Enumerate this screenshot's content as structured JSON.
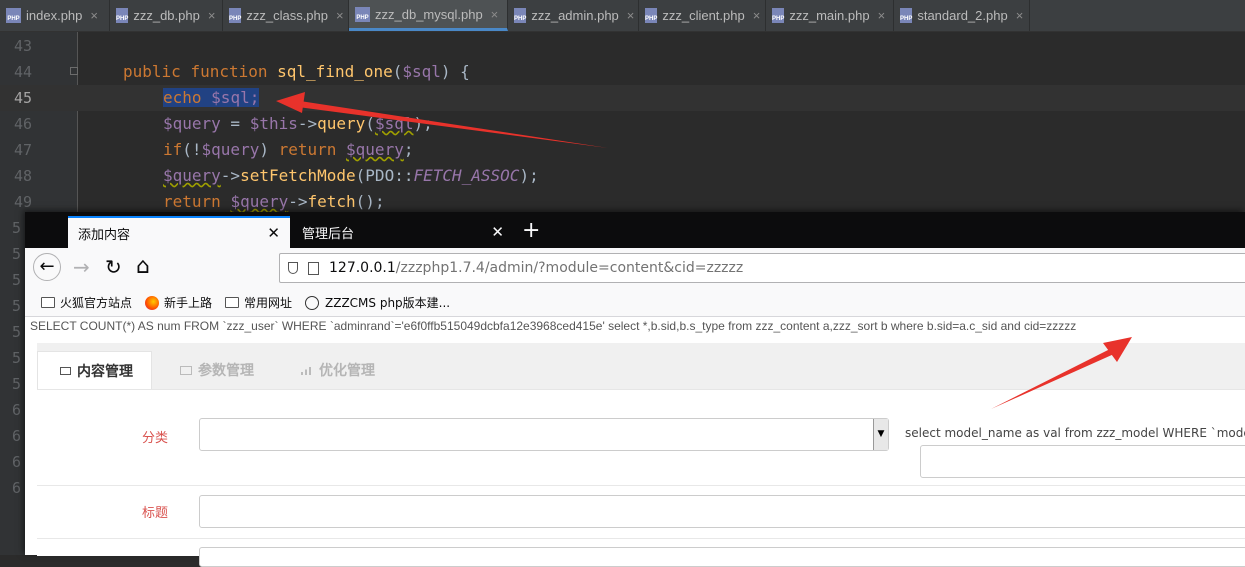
{
  "ide": {
    "tabs": [
      {
        "label": "index.php",
        "active": false
      },
      {
        "label": "zzz_db.php",
        "active": false
      },
      {
        "label": "zzz_class.php",
        "active": false
      },
      {
        "label": "zzz_db_mysql.php",
        "active": true
      },
      {
        "label": "zzz_admin.php",
        "active": false
      },
      {
        "label": "zzz_client.php",
        "active": false
      },
      {
        "label": "zzz_main.php",
        "active": false
      },
      {
        "label": "standard_2.php",
        "active": false
      }
    ],
    "php_icon_text": "PHP",
    "lines": {
      "l43": "43",
      "l44": "44",
      "l45": "45",
      "l46": "46",
      "l47": "47",
      "l48": "48",
      "l49": "49"
    },
    "code": {
      "kw_public": "public",
      "kw_function": "function",
      "fn_name": "sql_find_one",
      "open_paren": "(",
      "param_sql": "$sql",
      "close_brace_open": ") {",
      "kw_echo": "echo",
      "echo_var": "$sql;",
      "query_var": "$query",
      "assign": " = ",
      "this_var": "$this",
      "arrow": "->",
      "query_fn": "query",
      "arg_sql": "$sql",
      "close_stmt": ");",
      "kw_if": "if",
      "if_open": "(!",
      "if_var": "$query",
      "if_close": ") ",
      "kw_return": "return",
      "ret_var": "$query",
      "semi": ";",
      "fetchmode_fn": "setFetchMode",
      "pdo": "PDO",
      "dcolon": "::",
      "fetch_assoc": "FETCH_ASSOC",
      "fetch_fn": "fetch",
      "fetch_end": "();"
    },
    "left_gutter_numbers": [
      "5",
      "5",
      "5",
      "5",
      "5",
      "5",
      "5",
      "6",
      "6",
      "6",
      "6"
    ]
  },
  "browser": {
    "tabs": [
      {
        "label": "添加内容",
        "active": true
      },
      {
        "label": "管理后台",
        "active": false
      }
    ],
    "close_glyph": "✕",
    "new_tab_glyph": "+",
    "nav": {
      "back": "←",
      "forward": "→",
      "reload": "↻",
      "home": "⌂"
    },
    "url_host": "127.0.0.1",
    "url_path": "/zzzphp1.7.4/admin/?module=content&cid=zzzzz",
    "bookmarks": [
      "火狐官方站点",
      "新手上路",
      "常用网址",
      "ZZZCMS php版本建..."
    ],
    "sql_debug": "SELECT COUNT(*) AS num FROM `zzz_user` WHERE `adminrand`='e6f0ffb515049dcbfa12e3968ced415e' select *,b.sid,b.s_type from zzz_content a,zzz_sort b where b.sid=a.c_sid and cid=zzzzz",
    "panel_tabs": [
      "内容管理",
      "参数管理",
      "优化管理"
    ],
    "form": {
      "category_label": "分类",
      "title_label": "标题",
      "side_sql": "select model_name as val from zzz_model WHERE `model"
    }
  },
  "colors": {
    "arrow": "#e8322b",
    "selection": "#214283",
    "tab_accent": "#0a84ff"
  }
}
